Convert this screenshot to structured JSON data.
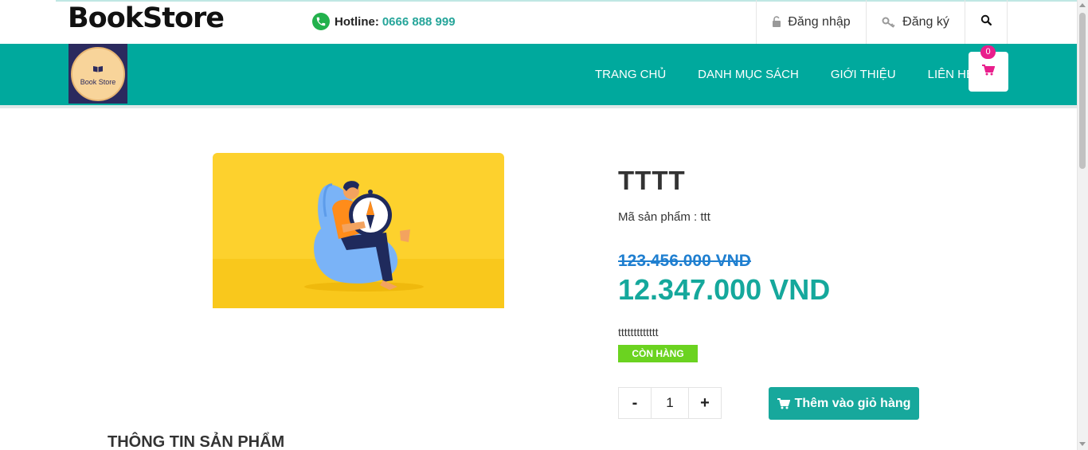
{
  "header": {
    "brand": "BookStore",
    "hotline_label": "Hotline:",
    "hotline_number": "0666 888 999",
    "login": "Đăng nhập",
    "register": "Đăng ký"
  },
  "logo": {
    "text": "Book Store"
  },
  "nav": {
    "items": [
      "TRANG CHỦ",
      "DANH MỤC SÁCH",
      "GIỚI THIỆU",
      "LIÊN HỆ"
    ],
    "cart_count": "0"
  },
  "product": {
    "title": "TTTT",
    "sku_line": "Mã sản phẩm : ttt",
    "old_price": "123.456.000 VND",
    "new_price": "12.347.000 VND",
    "description": "ttttttttttttt",
    "stock_status": "CÒN HÀNG",
    "quantity": "1",
    "minus_label": "-",
    "plus_label": "+",
    "add_to_cart": "Thêm vào giỏ hàng"
  },
  "section": {
    "title": "THÔNG TIN SẢN PHẨM"
  },
  "colors": {
    "primary": "#00a99d",
    "badge": "#e91e8c",
    "stock": "#6bd320",
    "old_price": "#1f7fd0"
  },
  "icons": [
    "phone-icon",
    "lock-icon",
    "key-icon",
    "search-icon",
    "cart-icon",
    "book-icon"
  ]
}
